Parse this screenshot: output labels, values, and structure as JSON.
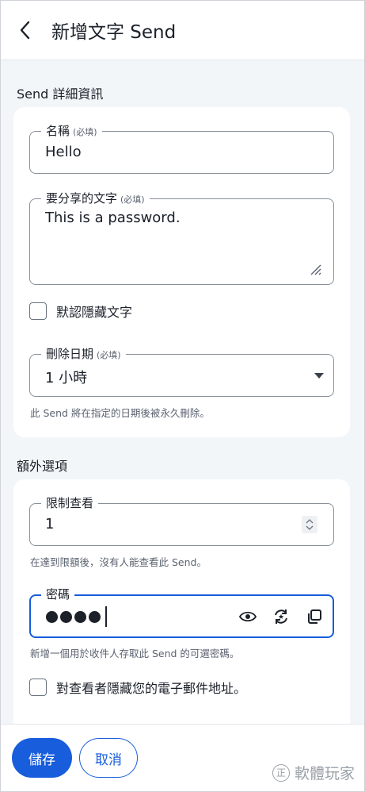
{
  "header": {
    "title": "新增文字 Send"
  },
  "details": {
    "heading": "Send 詳細資訊",
    "name": {
      "label": "名稱",
      "required": "(必填)",
      "value": "Hello"
    },
    "text": {
      "label": "要分享的文字",
      "required": "(必填)",
      "value": "This is a password."
    },
    "hide_text": {
      "label": "默認隱藏文字",
      "checked": false
    },
    "deletion": {
      "label": "刪除日期",
      "required": "(必填)",
      "value": "1 小時",
      "hint": "此 Send 將在指定的日期後被永久刪除。"
    }
  },
  "options": {
    "heading": "額外選項",
    "max_views": {
      "label": "限制查看",
      "value": "1",
      "hint": "在達到限額後，沒有人能查看此 Send。"
    },
    "password": {
      "label": "密碼",
      "masked_length": 4,
      "hint": "新增一個用於收件人存取此 Send 的可選密碼。"
    },
    "hide_email": {
      "label": "對查看者隱藏您的電子郵件地址。",
      "checked": false
    }
  },
  "footer": {
    "save_label": "儲存",
    "cancel_label": "取消"
  },
  "watermark": {
    "text": "軟體玩家",
    "symbol": "正"
  },
  "icons": [
    "chevron-left-icon",
    "resize-grip-icon",
    "caret-down-icon",
    "stepper-icon",
    "eye-icon",
    "refresh-icon",
    "copy-icon"
  ],
  "colors": {
    "primary": "#175ddc",
    "background": "#f3f6f9",
    "text": "#1b2029",
    "muted": "#5a6270"
  }
}
